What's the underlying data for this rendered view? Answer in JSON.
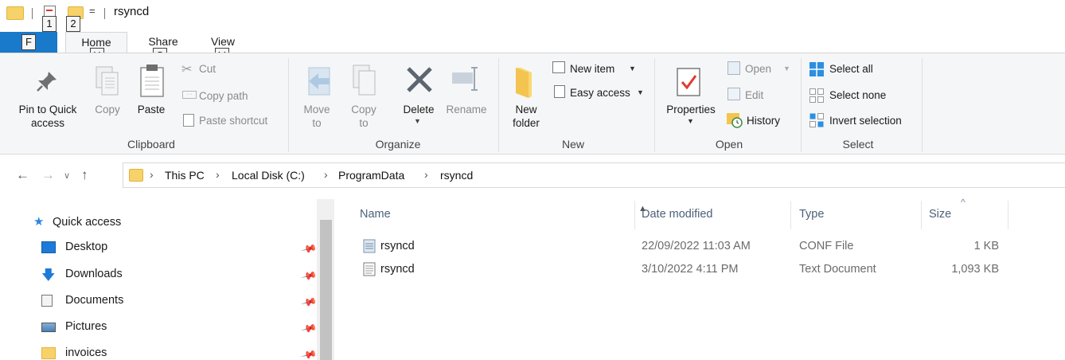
{
  "window": {
    "title": "rsyncd"
  },
  "quick_access_toolbar": {
    "keytips": [
      "1",
      "2"
    ],
    "dropdown_glyph": "="
  },
  "tabs": {
    "file": {
      "keytip": "F"
    },
    "items": [
      {
        "label": "Home",
        "keytip": "H"
      },
      {
        "label": "Share",
        "keytip": "S"
      },
      {
        "label": "View",
        "keytip": "V"
      }
    ]
  },
  "ribbon": {
    "clipboard": {
      "group_label": "Clipboard",
      "pin_label_1": "Pin to Quick",
      "pin_label_2": "access",
      "copy": "Copy",
      "paste": "Paste",
      "cut": "Cut",
      "copy_path": "Copy path",
      "paste_shortcut": "Paste shortcut"
    },
    "organize": {
      "group_label": "Organize",
      "move_to_1": "Move",
      "move_to_2": "to",
      "copy_to_1": "Copy",
      "copy_to_2": "to",
      "delete": "Delete",
      "rename": "Rename"
    },
    "new": {
      "group_label": "New",
      "new_folder_1": "New",
      "new_folder_2": "folder",
      "new_item": "New item",
      "easy_access": "Easy access"
    },
    "open": {
      "group_label": "Open",
      "properties": "Properties",
      "open": "Open",
      "edit": "Edit",
      "history": "History"
    },
    "select": {
      "group_label": "Select",
      "select_all": "Select all",
      "select_none": "Select none",
      "invert_selection": "Invert selection"
    }
  },
  "address": {
    "breadcrumb": [
      "This PC",
      "Local Disk (C:)",
      "ProgramData",
      "rsyncd"
    ]
  },
  "nav_pane": {
    "quick_access": "Quick access",
    "items": [
      {
        "label": "Desktop",
        "icon": "desktop-icon"
      },
      {
        "label": "Downloads",
        "icon": "downloads-icon"
      },
      {
        "label": "Documents",
        "icon": "documents-icon"
      },
      {
        "label": "Pictures",
        "icon": "pictures-icon"
      },
      {
        "label": "invoices",
        "icon": "folder-icon"
      }
    ]
  },
  "file_list": {
    "columns": {
      "name": "Name",
      "date": "Date modified",
      "type": "Type",
      "size": "Size"
    },
    "rows": [
      {
        "name": "rsyncd",
        "date": "22/09/2022 11:03 AM",
        "type": "CONF File",
        "size": "1 KB",
        "icon": "conf-file-icon"
      },
      {
        "name": "rsyncd",
        "date": "3/10/2022 4:11 PM",
        "type": "Text Document",
        "size": "1,093 KB",
        "icon": "text-file-icon"
      }
    ]
  },
  "colors": {
    "file_tab": "#1979ca",
    "folder": "#f7d268",
    "header_text": "#4c607a",
    "accent": "#1e7ad8"
  }
}
